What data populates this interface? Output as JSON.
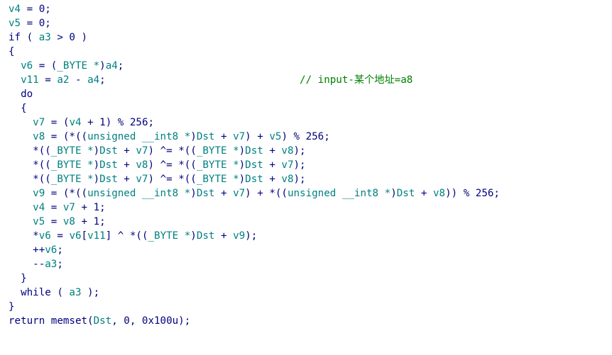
{
  "colors": {
    "background": "#ffffff",
    "plain": "#000080",
    "variable": "#008080",
    "comment": "#008000"
  },
  "lines": [
    {
      "tokens": [
        {
          "t": "v4",
          "k": "var"
        },
        {
          "t": " = 0;",
          "k": "op"
        }
      ]
    },
    {
      "tokens": [
        {
          "t": "v5",
          "k": "var"
        },
        {
          "t": " = 0;",
          "k": "op"
        }
      ]
    },
    {
      "tokens": [
        {
          "t": "if",
          "k": "kw"
        },
        {
          "t": " ( ",
          "k": "op"
        },
        {
          "t": "a3",
          "k": "var"
        },
        {
          "t": " > 0 )",
          "k": "op"
        }
      ]
    },
    {
      "tokens": [
        {
          "t": "{",
          "k": "op"
        }
      ]
    },
    {
      "tokens": [
        {
          "t": "  ",
          "k": "op"
        },
        {
          "t": "v6",
          "k": "var"
        },
        {
          "t": " = (",
          "k": "op"
        },
        {
          "t": "_BYTE *",
          "k": "typ"
        },
        {
          "t": ")",
          "k": "op"
        },
        {
          "t": "a4",
          "k": "var"
        },
        {
          "t": ";",
          "k": "op"
        }
      ]
    },
    {
      "tokens": [
        {
          "t": "  ",
          "k": "op"
        },
        {
          "t": "v11",
          "k": "var"
        },
        {
          "t": " = ",
          "k": "op"
        },
        {
          "t": "a2",
          "k": "var"
        },
        {
          "t": " - ",
          "k": "op"
        },
        {
          "t": "a4",
          "k": "var"
        },
        {
          "t": ";                                ",
          "k": "op"
        },
        {
          "t": "// input-某个地址=a8",
          "k": "cmt"
        }
      ]
    },
    {
      "tokens": [
        {
          "t": "  do",
          "k": "kw"
        }
      ]
    },
    {
      "tokens": [
        {
          "t": "  {",
          "k": "op"
        }
      ]
    },
    {
      "tokens": [
        {
          "t": "    ",
          "k": "op"
        },
        {
          "t": "v7",
          "k": "var"
        },
        {
          "t": " = (",
          "k": "op"
        },
        {
          "t": "v4",
          "k": "var"
        },
        {
          "t": " + 1) % 256;",
          "k": "op"
        }
      ]
    },
    {
      "tokens": [
        {
          "t": "    ",
          "k": "op"
        },
        {
          "t": "v8",
          "k": "var"
        },
        {
          "t": " = (*((",
          "k": "op"
        },
        {
          "t": "unsigned __int8 *",
          "k": "typ"
        },
        {
          "t": ")",
          "k": "op"
        },
        {
          "t": "Dst",
          "k": "var"
        },
        {
          "t": " + ",
          "k": "op"
        },
        {
          "t": "v7",
          "k": "var"
        },
        {
          "t": ") + ",
          "k": "op"
        },
        {
          "t": "v5",
          "k": "var"
        },
        {
          "t": ") % 256;",
          "k": "op"
        }
      ]
    },
    {
      "tokens": [
        {
          "t": "    *((",
          "k": "op"
        },
        {
          "t": "_BYTE *",
          "k": "typ"
        },
        {
          "t": ")",
          "k": "op"
        },
        {
          "t": "Dst",
          "k": "var"
        },
        {
          "t": " + ",
          "k": "op"
        },
        {
          "t": "v7",
          "k": "var"
        },
        {
          "t": ") ^= *((",
          "k": "op"
        },
        {
          "t": "_BYTE *",
          "k": "typ"
        },
        {
          "t": ")",
          "k": "op"
        },
        {
          "t": "Dst",
          "k": "var"
        },
        {
          "t": " + ",
          "k": "op"
        },
        {
          "t": "v8",
          "k": "var"
        },
        {
          "t": ");",
          "k": "op"
        }
      ]
    },
    {
      "tokens": [
        {
          "t": "    *((",
          "k": "op"
        },
        {
          "t": "_BYTE *",
          "k": "typ"
        },
        {
          "t": ")",
          "k": "op"
        },
        {
          "t": "Dst",
          "k": "var"
        },
        {
          "t": " + ",
          "k": "op"
        },
        {
          "t": "v8",
          "k": "var"
        },
        {
          "t": ") ^= *((",
          "k": "op"
        },
        {
          "t": "_BYTE *",
          "k": "typ"
        },
        {
          "t": ")",
          "k": "op"
        },
        {
          "t": "Dst",
          "k": "var"
        },
        {
          "t": " + ",
          "k": "op"
        },
        {
          "t": "v7",
          "k": "var"
        },
        {
          "t": ");",
          "k": "op"
        }
      ]
    },
    {
      "tokens": [
        {
          "t": "    *((",
          "k": "op"
        },
        {
          "t": "_BYTE *",
          "k": "typ"
        },
        {
          "t": ")",
          "k": "op"
        },
        {
          "t": "Dst",
          "k": "var"
        },
        {
          "t": " + ",
          "k": "op"
        },
        {
          "t": "v7",
          "k": "var"
        },
        {
          "t": ") ^= *((",
          "k": "op"
        },
        {
          "t": "_BYTE *",
          "k": "typ"
        },
        {
          "t": ")",
          "k": "op"
        },
        {
          "t": "Dst",
          "k": "var"
        },
        {
          "t": " + ",
          "k": "op"
        },
        {
          "t": "v8",
          "k": "var"
        },
        {
          "t": ");",
          "k": "op"
        }
      ]
    },
    {
      "tokens": [
        {
          "t": "    ",
          "k": "op"
        },
        {
          "t": "v9",
          "k": "var"
        },
        {
          "t": " = (*((",
          "k": "op"
        },
        {
          "t": "unsigned __int8 *",
          "k": "typ"
        },
        {
          "t": ")",
          "k": "op"
        },
        {
          "t": "Dst",
          "k": "var"
        },
        {
          "t": " + ",
          "k": "op"
        },
        {
          "t": "v7",
          "k": "var"
        },
        {
          "t": ") + *((",
          "k": "op"
        },
        {
          "t": "unsigned __int8 *",
          "k": "typ"
        },
        {
          "t": ")",
          "k": "op"
        },
        {
          "t": "Dst",
          "k": "var"
        },
        {
          "t": " + ",
          "k": "op"
        },
        {
          "t": "v8",
          "k": "var"
        },
        {
          "t": ")) % 256;",
          "k": "op"
        }
      ]
    },
    {
      "tokens": [
        {
          "t": "    ",
          "k": "op"
        },
        {
          "t": "v4",
          "k": "var"
        },
        {
          "t": " = ",
          "k": "op"
        },
        {
          "t": "v7",
          "k": "var"
        },
        {
          "t": " + 1;",
          "k": "op"
        }
      ]
    },
    {
      "tokens": [
        {
          "t": "    ",
          "k": "op"
        },
        {
          "t": "v5",
          "k": "var"
        },
        {
          "t": " = ",
          "k": "op"
        },
        {
          "t": "v8",
          "k": "var"
        },
        {
          "t": " + 1;",
          "k": "op"
        }
      ]
    },
    {
      "tokens": [
        {
          "t": "    *",
          "k": "op"
        },
        {
          "t": "v6",
          "k": "var"
        },
        {
          "t": " = ",
          "k": "op"
        },
        {
          "t": "v6",
          "k": "var"
        },
        {
          "t": "[",
          "k": "op"
        },
        {
          "t": "v11",
          "k": "var"
        },
        {
          "t": "] ^ *((",
          "k": "op"
        },
        {
          "t": "_BYTE *",
          "k": "typ"
        },
        {
          "t": ")",
          "k": "op"
        },
        {
          "t": "Dst",
          "k": "var"
        },
        {
          "t": " + ",
          "k": "op"
        },
        {
          "t": "v9",
          "k": "var"
        },
        {
          "t": ");",
          "k": "op"
        }
      ]
    },
    {
      "tokens": [
        {
          "t": "    ++",
          "k": "op"
        },
        {
          "t": "v6",
          "k": "var"
        },
        {
          "t": ";",
          "k": "op"
        }
      ]
    },
    {
      "tokens": [
        {
          "t": "    --",
          "k": "op"
        },
        {
          "t": "a3",
          "k": "var"
        },
        {
          "t": ";",
          "k": "op"
        }
      ]
    },
    {
      "tokens": [
        {
          "t": "  }",
          "k": "op"
        }
      ]
    },
    {
      "tokens": [
        {
          "t": "  while",
          "k": "kw"
        },
        {
          "t": " ( ",
          "k": "op"
        },
        {
          "t": "a3",
          "k": "var"
        },
        {
          "t": " );",
          "k": "op"
        }
      ]
    },
    {
      "tokens": [
        {
          "t": "}",
          "k": "op"
        }
      ]
    },
    {
      "tokens": [
        {
          "t": "return",
          "k": "kw"
        },
        {
          "t": " ",
          "k": "op"
        },
        {
          "t": "memset",
          "k": "fn"
        },
        {
          "t": "(",
          "k": "op"
        },
        {
          "t": "Dst",
          "k": "var"
        },
        {
          "t": ", 0, 0x100u);",
          "k": "op"
        }
      ]
    }
  ]
}
